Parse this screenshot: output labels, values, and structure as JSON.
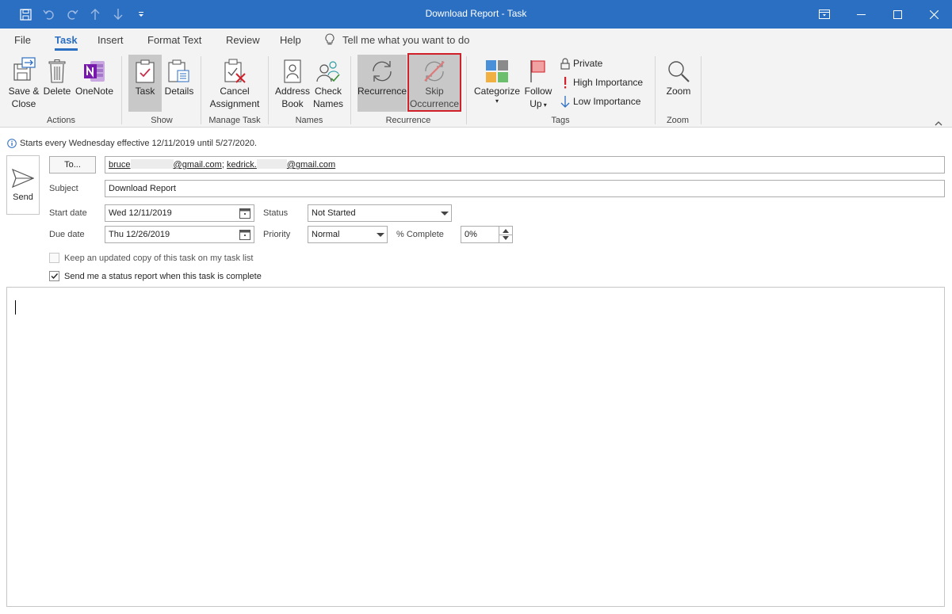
{
  "window": {
    "title": "Download Report  -  Task"
  },
  "tabs": {
    "file": "File",
    "task": "Task",
    "insert": "Insert",
    "format_text": "Format Text",
    "review": "Review",
    "help": "Help",
    "tell_me": "Tell me what you want to do"
  },
  "ribbon": {
    "actions": {
      "label": "Actions",
      "save_close_1": "Save &",
      "save_close_2": "Close",
      "delete": "Delete",
      "onenote": "OneNote"
    },
    "show": {
      "label": "Show",
      "task": "Task",
      "details": "Details"
    },
    "manage": {
      "label": "Manage Task",
      "cancel_1": "Cancel",
      "cancel_2": "Assignment"
    },
    "names": {
      "label": "Names",
      "address_1": "Address",
      "address_2": "Book",
      "check_1": "Check",
      "check_2": "Names"
    },
    "recurrence": {
      "label": "Recurrence",
      "recurrence": "Recurrence",
      "skip_1": "Skip",
      "skip_2": "Occurrence"
    },
    "tags": {
      "label": "Tags",
      "categorize": "Categorize",
      "follow_1": "Follow",
      "follow_2": "Up",
      "private": "Private",
      "high": "High Importance",
      "low": "Low Importance"
    },
    "zoom": {
      "label": "Zoom",
      "zoom": "Zoom"
    }
  },
  "info": {
    "text": "Starts every Wednesday effective 12/11/2019 until 5/27/2020."
  },
  "form": {
    "send": "Send",
    "to_button": "To...",
    "recipient_1_a": "bruce",
    "recipient_1_b": "@gmail.com",
    "recipient_sep": ";",
    "recipient_2_a": "kedrick.",
    "recipient_2_b": "@gmail.com",
    "subject_label": "Subject",
    "subject_value": "Download Report",
    "start_label": "Start date",
    "start_value": "Wed 12/11/2019",
    "due_label": "Due date",
    "due_value": "Thu 12/26/2019",
    "status_label": "Status",
    "status_value": "Not Started",
    "priority_label": "Priority",
    "priority_value": "Normal",
    "complete_label": "% Complete",
    "complete_value": "0%",
    "keep_copy": "Keep an updated copy of this task on my task list",
    "status_report": "Send me a status report when this task is complete"
  },
  "colors": {
    "titlebar": "#2b6fc3",
    "accent": "#2b6fc3",
    "highlight": "#d0202a"
  },
  "icons": {
    "qat": [
      "save-icon",
      "undo-icon",
      "redo-icon",
      "up-arrow-icon",
      "down-arrow-icon",
      "customize-qat-icon"
    ],
    "window": [
      "ribbon-display-icon",
      "minimize-icon",
      "maximize-icon",
      "close-icon"
    ]
  }
}
